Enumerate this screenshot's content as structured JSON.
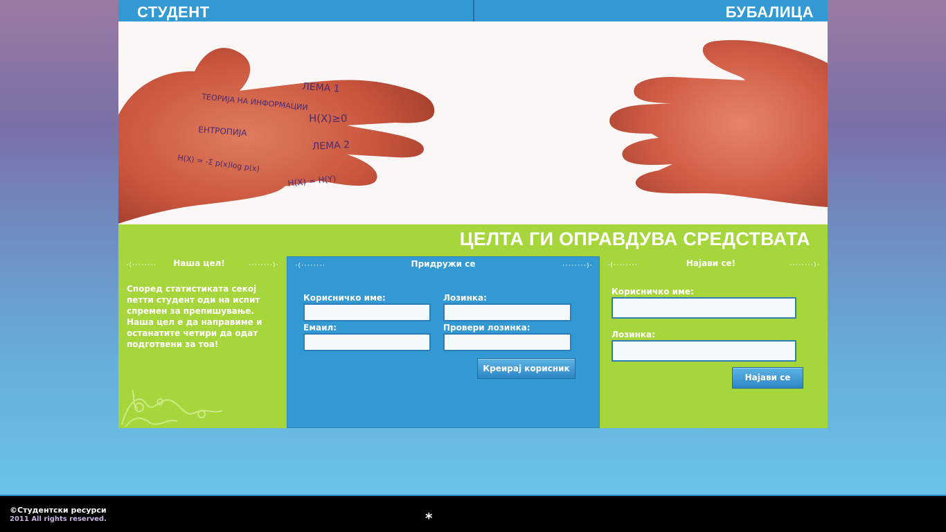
{
  "header": {
    "brand_left": "СТУДЕНТ",
    "brand_right": "БУБАЛИЦА"
  },
  "hero": {
    "palm_notes": [
      "ЛЕМА 1",
      "ТЕОРИЈА НА ИНФОРМАЦИИ",
      "H(X)≥0",
      "ЕНТРОПИЈА",
      "ЛЕМА 2",
      "H(X) = -Σ p(x)log p(x)",
      "H(X) = H(Y)"
    ]
  },
  "slogan": "ЦЕЛТА ГИ ОПРАВДУВА СРЕДСТВАТА",
  "about": {
    "title": "Наша цел!",
    "text": "Според статистиката секој петти студент оди на испит спремен за препишување. Наша цел е да направиме и останатите четири да одат подготвени за тоа!"
  },
  "register": {
    "title": "Придружи се",
    "username_label": "Корисничко име:",
    "password_label": "Лозинка:",
    "email_label": "Емаил:",
    "confirm_label": "Провери лозинка:",
    "username_value": "",
    "password_value": "",
    "email_value": "",
    "confirm_value": "",
    "submit_label": "Креирај корисник"
  },
  "login": {
    "title": "Најави се!",
    "username_label": "Корисничко име:",
    "password_label": "Лозинка:",
    "username_value": "",
    "password_value": "",
    "submit_label": "Најави се"
  },
  "footer": {
    "copyright": "©Студентски ресурси",
    "rights": "2011 All rights reserved.",
    "star": "*"
  },
  "colors": {
    "blue": "#3399d3",
    "green": "#a6d63b",
    "footer": "#000000"
  }
}
